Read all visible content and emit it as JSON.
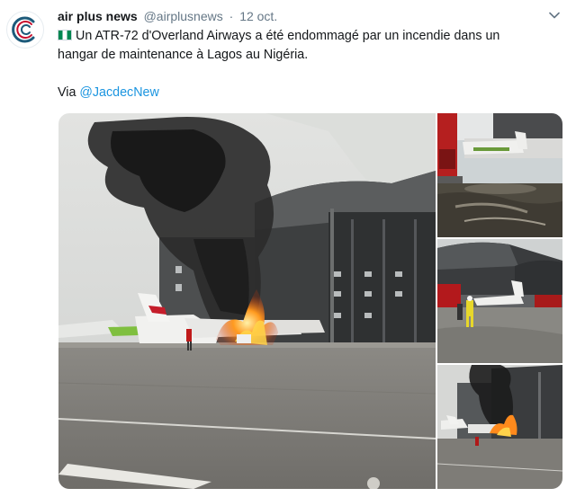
{
  "tweet": {
    "author_name": "air plus news",
    "author_handle": "@airplusnews",
    "separator": "·",
    "timestamp": "12 oct.",
    "flag_icon": "nigeria-flag-emoji",
    "text_line_1": "Un ATR-72 d'Overland Airways a été endommagé par un incendie dans un",
    "text_line_2": "hangar de maintenance à Lagos au Nigéria.",
    "via_prefix": "Via ",
    "via_mention": "@JacdecNew"
  },
  "media": {
    "photo_count": 4,
    "photos": [
      {
        "name": "hangar-fire-main-photo"
      },
      {
        "name": "fire-truck-aircraft-photo"
      },
      {
        "name": "firefighter-hangar-photo"
      },
      {
        "name": "hangar-fire-small-photo"
      }
    ]
  },
  "colors": {
    "link": "#1b95e0",
    "secondary_text": "#657786",
    "primary_text": "#14171a",
    "avatar_accent": "#1d5a7a"
  }
}
